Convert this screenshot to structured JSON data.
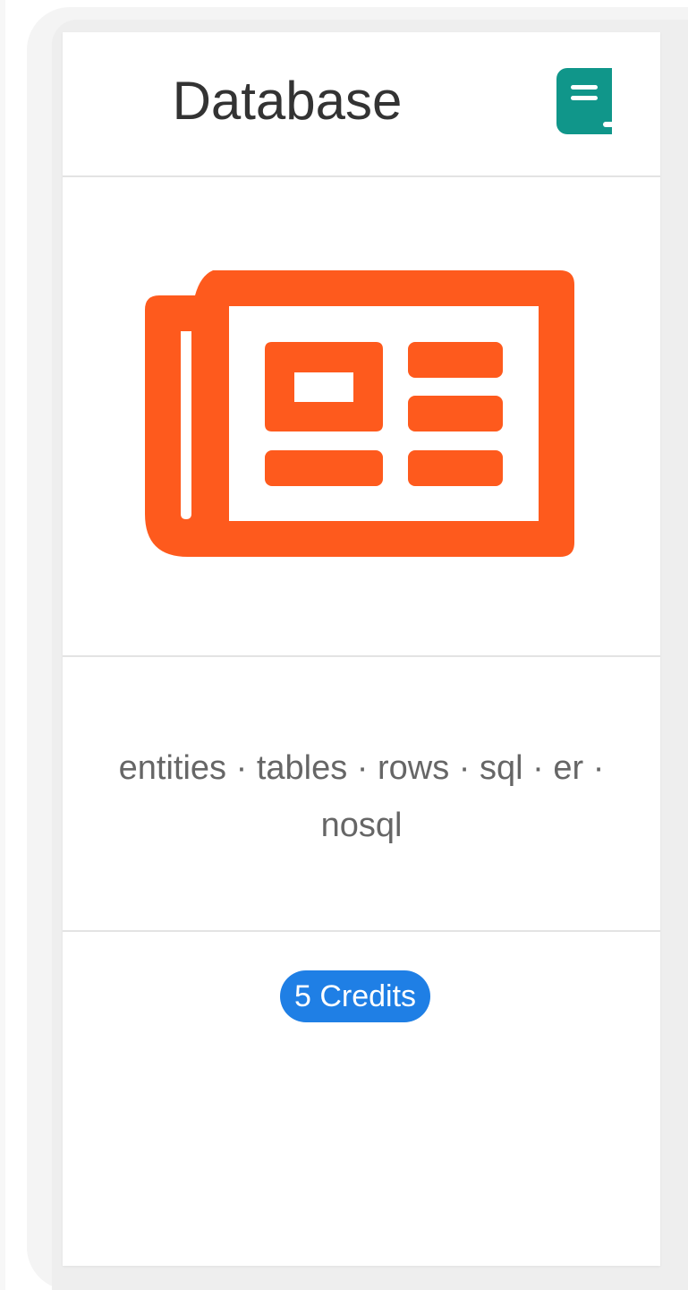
{
  "card": {
    "title": "Database",
    "action_icon": "book-icon",
    "image_icon": "newspaper-icon",
    "tags": "entities · tables · rows · sql · er · nosql",
    "credits_label": "5 Credits"
  },
  "colors": {
    "title_text": "#333333",
    "book_icon": "#10968a",
    "newspaper_icon": "#fe5a1d",
    "tags_text": "#666666",
    "credits_badge": "#1f7fe5",
    "divider": "#e3e3e3"
  }
}
